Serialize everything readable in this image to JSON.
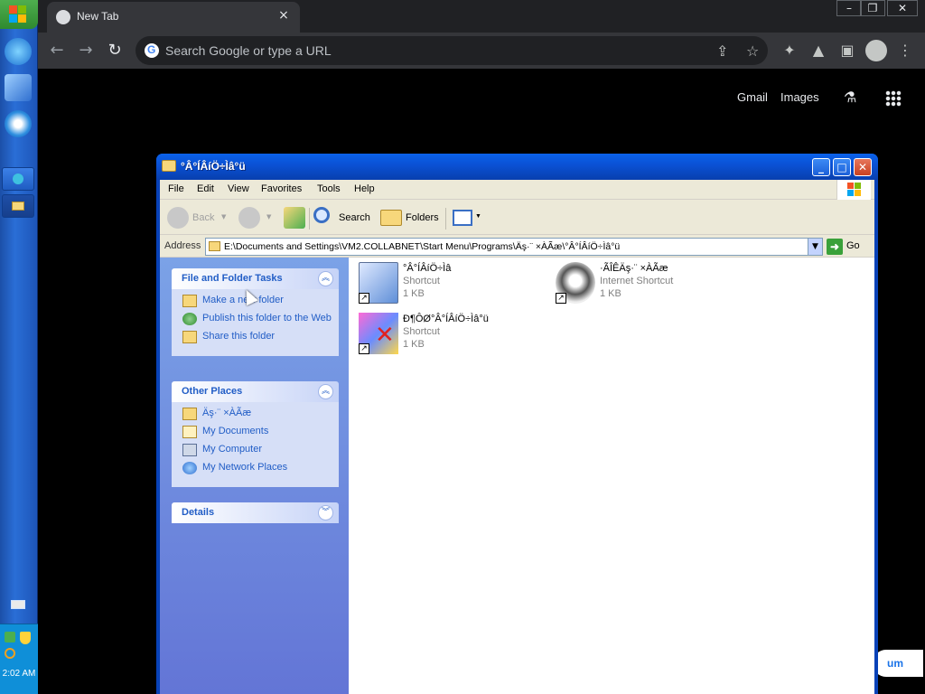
{
  "taskbar": {
    "clock": "2:02 AM"
  },
  "chrome": {
    "tab_title": "New Tab",
    "tab_close": "×",
    "omnibox_placeholder": "Search Google or type a URL",
    "ntp_links": [
      "Gmail",
      "Images"
    ],
    "partial_button": "um",
    "window_controls": [
      "–",
      "❐",
      "✕"
    ]
  },
  "explorer": {
    "title": "°Â°ÍÂíÖ÷Ìâ°ü",
    "menu": [
      "File",
      "Edit",
      "View",
      "Favorites",
      "Tools",
      "Help"
    ],
    "toolbar": {
      "back": "Back",
      "search": "Search",
      "folders": "Folders"
    },
    "address": {
      "label": "Address",
      "value": "E:\\Documents and Settings\\VM2.COLLABNET\\Start Menu\\Programs\\Äş·¨ ×ÀÃæ\\°Â°ÍÂíÖ÷Ìâ°ü",
      "go": "Go"
    },
    "file_tasks": {
      "title": "File and Folder Tasks",
      "items": [
        "Make a new folder",
        "Publish this folder to the Web",
        "Share this folder"
      ]
    },
    "other_places": {
      "title": "Other Places",
      "items": [
        "Äş·¨ ×ÀÃæ",
        "My Documents",
        "My Computer",
        "My Network Places"
      ]
    },
    "details": {
      "title": "Details"
    },
    "files": [
      {
        "name": "°Â°ÍÂíÖ÷Ìâ",
        "type": "Shortcut",
        "size": "1 KB"
      },
      {
        "name": "·ÃÎÊÄş·¨ ×ÀÃæ",
        "type": "Internet Shortcut",
        "size": "1 KB"
      },
      {
        "name": "Ð¶ÔØ°Â°ÍÂíÖ÷Ìâ°ü",
        "type": "Shortcut",
        "size": "1 KB"
      }
    ]
  },
  "colors": {
    "xp_title_blue": "#0a52d6",
    "taskpane_link": "#215dc6",
    "chrome_toolbar": "#35363a"
  }
}
